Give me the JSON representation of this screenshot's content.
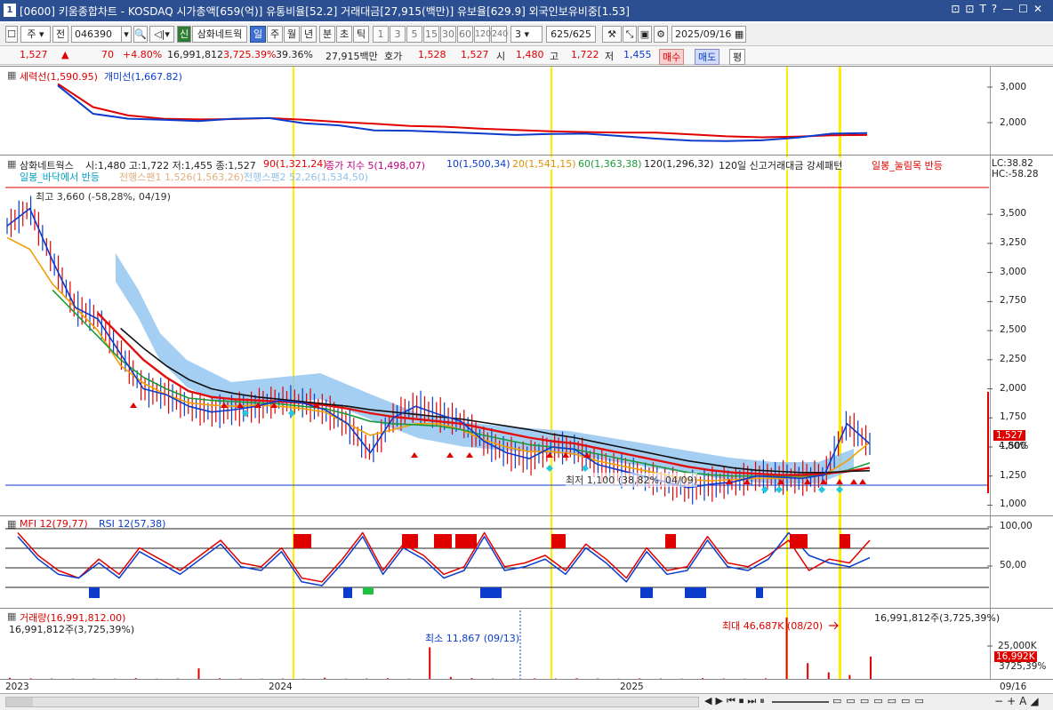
{
  "title": {
    "number": "1",
    "text": "[0600] 키움종합차트 - KOSDAQ 시가총액[659(억)] 유통비율[52.2] 거래대금[27,915(백만)] 유보율[629.9] 외국인보유비중[1.53]",
    "icons": [
      "restore-icon",
      "pin-icon",
      "font-icon",
      "help-icon",
      "minimize-icon",
      "maximize-icon",
      "close-icon"
    ],
    "icon_glyphs": [
      "⊡",
      "⊡",
      "T",
      "?",
      "—",
      "☐",
      "✕"
    ]
  },
  "toolbar": {
    "period_label": "주",
    "prev_label": "전",
    "code": "046390",
    "sin_label": "신",
    "stock_name": "삼화네트웍",
    "timeframes": [
      "일",
      "주",
      "월",
      "년",
      "분",
      "초",
      "틱"
    ],
    "numbers": [
      "1",
      "3",
      "5",
      "15",
      "30",
      "60",
      "120",
      "240"
    ],
    "count_select": "3",
    "page_value": "625",
    "page_total": "/625",
    "date": "2025/09/16"
  },
  "info": {
    "price": "1,527",
    "arrow": "▲",
    "change": "70",
    "change_pct": "+4.80%",
    "volume": "16,991,812",
    "volume_pct": "3,725.39%",
    "ratio": "39.36%",
    "amount": "27,915백만",
    "hoga_label": "호가",
    "ask": "1,528",
    "bid": "1,527",
    "open_label": "시",
    "open": "1,480",
    "high_label": "고",
    "high": "1,722",
    "low_label": "저",
    "low": "1,455",
    "buy_label": "매수",
    "sell_label": "매도",
    "eval_label": "평"
  },
  "colors": {
    "up": "#e00000",
    "down": "#0b3ccc",
    "ma20": "#f0a000",
    "ma60": "#1a9a3a",
    "ma90": "#e01010",
    "ma120": "#111111",
    "cloud": "#7fb8ec",
    "highlight": "#ffee00"
  },
  "panels": {
    "force": {
      "legend1": "세력선(1,590.95)",
      "legend2": "개미선(1,667.82)",
      "ticks": [
        "3,000",
        "2,000"
      ],
      "chart_data": {
        "type": "line",
        "series": [
          {
            "name": "세력선",
            "color": "#e00000",
            "values": [
              3050,
              2350,
              2100,
              2000,
              1980,
              1990,
              2020,
              1970,
              1900,
              1850,
              1780,
              1760,
              1700,
              1660,
              1620,
              1600,
              1580,
              1580,
              1530,
              1470,
              1440,
              1460,
              1500,
              1510
            ]
          },
          {
            "name": "개미선",
            "color": "#0b3ccc",
            "values": [
              3000,
              2150,
              2000,
              1970,
              1930,
              2000,
              2020,
              1860,
              1800,
              1650,
              1640,
              1600,
              1560,
              1510,
              1540,
              1550,
              1480,
              1400,
              1340,
              1330,
              1350,
              1430,
              1550,
              1570
            ]
          }
        ],
        "ylim": [
          1000,
          3300
        ]
      }
    },
    "price": {
      "name": "삼화네트웍스",
      "ohlc": "시:1,480 고:1,722 저:1,455 종:1,527",
      "ma90": "90(1,321,24)",
      "ma5": "종가 지수 5(1,498,07)",
      "ma10": "10(1,500,34)",
      "ma20": "20(1,541,15)",
      "ma60": "60(1,363,38)",
      "ma120": "120(1,296,32)",
      "event1": "120일 신고거래대금 강세패턴",
      "event2": "일봉_눌림목 반등",
      "row2_a": "일봉_바닥에서 반등",
      "row2_b": "전행스팬1 1,526(1,563,26)",
      "row2_c": "전행스팬2 52,26(1,534,50)",
      "lc": "LC:38.82",
      "hc": "HC:-58.28",
      "max_label": "최고 3,660 (-58,28%, 04/19)",
      "min_label": "최저 1,100 (38,82%, 04/09)",
      "last_price": "1,527",
      "last_pct": "4.80%",
      "ticks": [
        "3,500",
        "3,250",
        "3,000",
        "2,750",
        "2,500",
        "2,250",
        "2,000",
        "1,750",
        "1,500",
        "1,250",
        "1,000"
      ],
      "chart_data": {
        "type": "line",
        "ylim": [
          950,
          3700
        ],
        "series": [
          {
            "name": "종가",
            "color": "#0b3ccc",
            "values": [
              3400,
              3550,
              3100,
              2700,
              2600,
              2300,
              2000,
              1950,
              1850,
              1800,
              1820,
              1850,
              1900,
              1880,
              1820,
              1700,
              1450,
              1750,
              1850,
              1780,
              1720,
              1550,
              1450,
              1400,
              1500,
              1480,
              1350,
              1300,
              1250,
              1200,
              1150,
              1180,
              1200,
              1250,
              1240,
              1230,
              1260,
              1700,
              1527
            ]
          },
          {
            "name": "20",
            "color": "#f0a000",
            "values": [
              3300,
              3200,
              2900,
              2700,
              2500,
              2200,
              2050,
              1950,
              1880,
              1860,
              1850,
              1860,
              1850,
              1830,
              1800,
              1700,
              1600,
              1650,
              1700,
              1700,
              1650,
              1560,
              1500,
              1460,
              1460,
              1440,
              1380,
              1340,
              1300,
              1260,
              1220,
              1210,
              1220,
              1230,
              1230,
              1240,
              1260,
              1380,
              1541
            ]
          },
          {
            "name": "60",
            "color": "#1a9a3a",
            "values": [
              null,
              null,
              2850,
              2650,
              2450,
              2250,
              2100,
              2000,
              1920,
              1900,
              1890,
              1880,
              1870,
              1850,
              1830,
              1780,
              1720,
              1700,
              1690,
              1680,
              1650,
              1600,
              1560,
              1520,
              1500,
              1480,
              1440,
              1400,
              1360,
              1320,
              1280,
              1260,
              1250,
              1250,
              1250,
              1250,
              1260,
              1300,
              1363
            ]
          },
          {
            "name": "90",
            "color": "#e01010",
            "values": [
              null,
              null,
              null,
              null,
              2650,
              2450,
              2250,
              2100,
              1980,
              1930,
              1910,
              1900,
              1890,
              1880,
              1860,
              1830,
              1790,
              1760,
              1740,
              1720,
              1700,
              1660,
              1620,
              1580,
              1550,
              1530,
              1490,
              1450,
              1410,
              1370,
              1330,
              1300,
              1280,
              1270,
              1260,
              1260,
              1270,
              1290,
              1321
            ]
          },
          {
            "name": "120",
            "color": "#111111",
            "values": [
              null,
              null,
              null,
              null,
              null,
              2520,
              2350,
              2200,
              2080,
              2000,
              1960,
              1930,
              1910,
              1890,
              1870,
              1850,
              1820,
              1800,
              1780,
              1760,
              1740,
              1710,
              1680,
              1650,
              1610,
              1580,
              1540,
              1500,
              1460,
              1420,
              1380,
              1350,
              1320,
              1300,
              1290,
              1280,
              1280,
              1290,
              1296
            ]
          }
        ]
      }
    },
    "mfi": {
      "legend1": "MFI 12(79,77)",
      "legend2": "RSI 12(57,38)",
      "ticks": [
        "100,00",
        "50,00"
      ],
      "chart_data": {
        "type": "line",
        "ylim": [
          0,
          100
        ],
        "series": [
          {
            "name": "MFI 12",
            "color": "#e00000",
            "values": [
              90,
              60,
              40,
              30,
              55,
              35,
              70,
              55,
              40,
              60,
              80,
              50,
              45,
              70,
              30,
              25,
              55,
              90,
              40,
              75,
              60,
              35,
              45,
              90,
              45,
              50,
              60,
              40,
              75,
              55,
              30,
              70,
              40,
              45,
              85,
              50,
              45,
              60,
              80,
              40,
              55,
              50,
              80
            ]
          },
          {
            "name": "RSI 12",
            "color": "#0b3ccc",
            "values": [
              85,
              55,
              35,
              30,
              50,
              30,
              65,
              50,
              35,
              55,
              75,
              45,
              40,
              65,
              25,
              20,
              50,
              85,
              35,
              70,
              55,
              30,
              40,
              85,
              40,
              45,
              55,
              35,
              70,
              50,
              25,
              65,
              35,
              40,
              80,
              45,
              40,
              55,
              90,
              60,
              50,
              45,
              57
            ]
          }
        ]
      }
    },
    "volume": {
      "legend": "거래량(16,991,812.00)",
      "legend_sub": "16,991,812주(3,725,39%)",
      "right_label": "16,991,812주(3,725,39%)",
      "min_label": "최소 11,867 (09/13)",
      "max_label": "최대 46,687K (08/20)",
      "ticks": [
        "25,000K"
      ],
      "last_value": "16,992K",
      "last_pct": "3725,39%",
      "chart_data": {
        "type": "bar",
        "ylim": [
          0,
          50000
        ],
        "values_k": [
          800,
          400,
          300,
          200,
          300,
          200,
          600,
          200,
          300,
          8000,
          500,
          300,
          200,
          300,
          200,
          900,
          200,
          300,
          500,
          200,
          24000,
          1500,
          600,
          300,
          200,
          400,
          300,
          500,
          300,
          200,
          400,
          300,
          200,
          600,
          300,
          200,
          400,
          46687,
          12000,
          5000,
          3000,
          16992
        ]
      }
    }
  },
  "xaxis": {
    "labels": [
      "2023",
      "2024",
      "2025"
    ],
    "right_label": "09/16"
  },
  "scroll": {
    "controls": [
      "◀",
      "▶",
      "⏮",
      "⏹",
      "⏭",
      "⏸",
      "−",
      "+",
      "A",
      "◢"
    ]
  }
}
